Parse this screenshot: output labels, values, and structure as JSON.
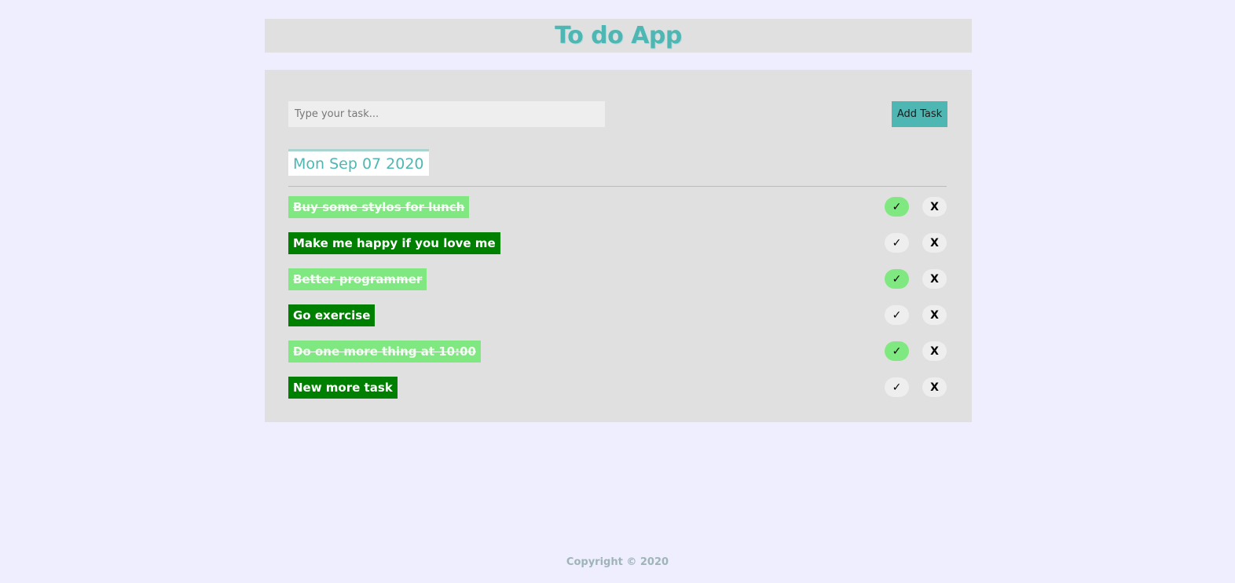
{
  "app": {
    "title": "To do App"
  },
  "form": {
    "placeholder": "Type your task...",
    "value": "",
    "add_label": "Add Task"
  },
  "date_tab": "Mon Sep 07 2020",
  "tasks": [
    {
      "text": "Buy some stylos for lunch",
      "done": true,
      "check_icon": "✓",
      "delete_icon": "X"
    },
    {
      "text": "Make me happy if you love me",
      "done": false,
      "check_icon": "✓",
      "delete_icon": "X"
    },
    {
      "text": "Better programmer",
      "done": true,
      "check_icon": "✓",
      "delete_icon": "X"
    },
    {
      "text": "Go exercise",
      "done": false,
      "check_icon": "✓",
      "delete_icon": "X"
    },
    {
      "text": "Do one more thing at 10:00",
      "done": true,
      "check_icon": "✓",
      "delete_icon": "X"
    },
    {
      "text": "New more task",
      "done": false,
      "check_icon": "✓",
      "delete_icon": "X"
    }
  ],
  "colors": {
    "accent": "#4fb7b3",
    "task_pending": "#008000",
    "task_done": "#80e880",
    "background": "#eeeeff",
    "panel": "#e0e0e0"
  },
  "footer": {
    "text": "Copyright © 2020"
  }
}
